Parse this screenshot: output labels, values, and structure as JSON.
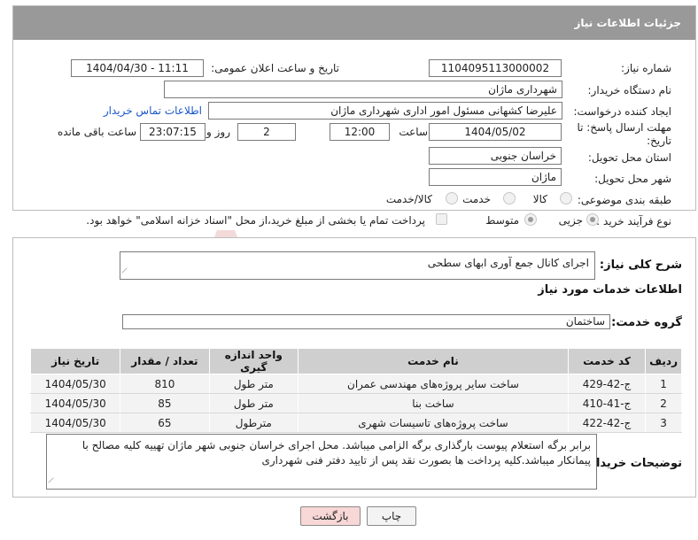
{
  "panel": {
    "title": "جزئیات اطلاعات نیاز"
  },
  "fields": {
    "need_number": {
      "label": "شماره نیاز:",
      "value": "1104095113000002"
    },
    "announce_datetime": {
      "label": "تاریخ و ساعت اعلان عمومی:",
      "value": "1404/04/30 - 11:11"
    },
    "buyer_org": {
      "label": "نام دستگاه خریدار:",
      "value": "شهرداری ماژان"
    },
    "requester": {
      "label": "ایجاد کننده درخواست:",
      "value": "علیرضا کشهانی مسئول امور اداری شهرداری ماژان",
      "contact_link": "اطلاعات تماس خریدار"
    },
    "deadline": {
      "label": "مهلت ارسال پاسخ: تا تاریخ:",
      "date": "1404/05/02",
      "time_label": "ساعت",
      "time": "12:00",
      "days": "2",
      "days_label": "روز و",
      "remaining": "23:07:15",
      "remaining_label": "ساعت باقی مانده"
    },
    "province": {
      "label": "استان محل تحویل:",
      "value": "خراسان جنوبی"
    },
    "city": {
      "label": "شهر محل تحویل:",
      "value": "ماژان"
    },
    "category": {
      "label": "طبقه بندی موضوعی:",
      "options": [
        "کالا",
        "خدمت",
        "کالا/خدمت"
      ]
    },
    "process": {
      "label": "نوع فرآیند خرید :",
      "options": [
        "جزیی",
        "متوسط"
      ],
      "payment_note": "پرداخت تمام یا بخشی از مبلغ خرید،از محل \"اسناد خزانه اسلامی\" خواهد بود."
    }
  },
  "summary": {
    "label": "شرح کلی نیاز:",
    "value": "اجرای کانال جمع آوری ابهای سطحی"
  },
  "services_title": "اطلاعات خدمات مورد نیاز",
  "service_group": {
    "label": "گروه خدمت:",
    "value": "ساختمان"
  },
  "table": {
    "headers": [
      "ردیف",
      "کد خدمت",
      "نام خدمت",
      "واحد اندازه گیری",
      "تعداد / مقدار",
      "تاریخ نیاز"
    ],
    "rows": [
      [
        "1",
        "ج-42-429",
        "ساخت سایر پروژه‌های مهندسی عمران",
        "متر طول",
        "810",
        "1404/05/30"
      ],
      [
        "2",
        "ج-41-410",
        "ساخت بنا",
        "متر طول",
        "85",
        "1404/05/30"
      ],
      [
        "3",
        "ج-42-422",
        "ساخت پروژه‌های تاسیسات شهری",
        "مترطول",
        "65",
        "1404/05/30"
      ]
    ]
  },
  "buyer_notes": {
    "label": "توضیحات خریدار:",
    "value": "برابر برگه استعلام پیوست بارگذاری برگه الزامی میباشد. محل اجرای خراسان جنوبی شهر ماژان  تهییه کلیه مصالح با پیمانکار میباشد.کلیه پرداخت ها بصورت نقد پس از تایید دفتر فنی شهرداری"
  },
  "buttons": {
    "print": "چاپ",
    "back": "بازگشت"
  },
  "colors": {
    "header": "#999999",
    "link": "#1a56c8",
    "back_button": "#f8d7d7",
    "print_button": "#f3f3f3"
  }
}
